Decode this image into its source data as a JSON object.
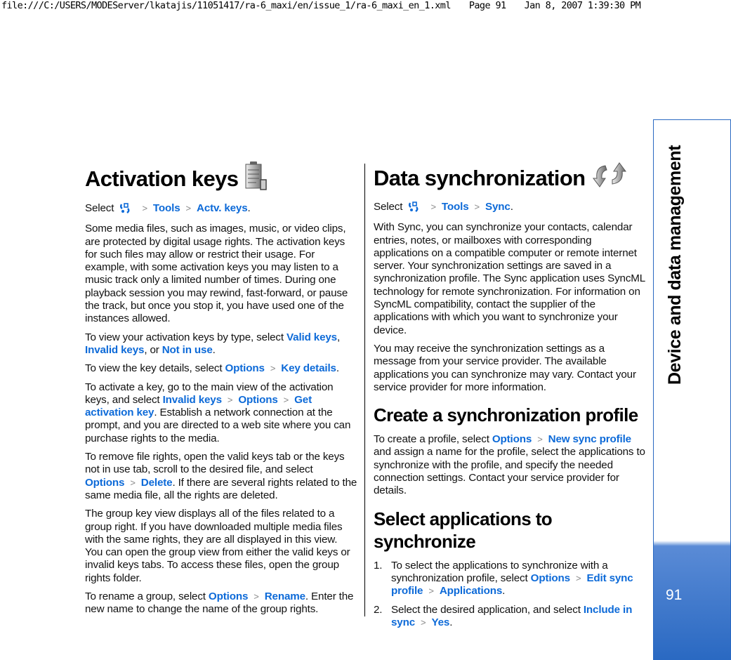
{
  "print_header": {
    "file_path": "file:///C:/USERS/MODEServer/lkatajis/11051417/ra-6_maxi/en/issue_1/ra-6_maxi_en_1.xml",
    "page_label": "Page 91",
    "timestamp": "Jan 8, 2007 1:39:30 PM"
  },
  "side_tab": {
    "chapter_title": "Device and data management",
    "page_number": "91",
    "accent_color": "#2a69c2"
  },
  "link_color": "#0d6ad8",
  "left_column": {
    "title": "Activation keys",
    "title_icon": "activation-keys-icon",
    "select_path": {
      "prefix": "Select",
      "menu_icon": "menu-key-icon",
      "items": [
        "Tools",
        "Actv. keys"
      ],
      "suffix": "."
    },
    "para1": "Some media files, such as images, music, or video clips, are protected by digital usage rights. The activation keys for such files may allow or restrict their usage. For example, with some activation keys you may listen to a music track only a limited number of times. During one playback session you may rewind, fast-forward, or pause the track, but once you stop it, you have used one of the instances allowed.",
    "para2": {
      "text_before": "To view your activation keys by type, select ",
      "link1": "Valid keys",
      "text_mid1": ", ",
      "link2": "Invalid keys",
      "text_mid2": ", or ",
      "link3": "Not in use",
      "text_after": "."
    },
    "para3": {
      "text_before": "To view the key details, select ",
      "link1": "Options",
      "link2": "Key details",
      "text_after": "."
    },
    "para4": {
      "text_before": "To activate a key, go to the main view of the activation keys, and select ",
      "link1": "Invalid keys",
      "link2": "Options",
      "link3": "Get activation key",
      "text_after": ". Establish a network connection at the prompt, and you are directed to a web site where you can purchase rights to the media."
    },
    "para5": {
      "text_before": "To remove file rights, open the valid keys tab or the keys not in use tab, scroll to the desired file, and select ",
      "link1": "Options",
      "link2": "Delete",
      "text_after": ". If there are several rights related to the same media file, all the rights are deleted."
    },
    "para6": "The group key view displays all of the files related to a group right. If you have downloaded multiple media files with the same rights, they are all displayed in this view. You can open the group view from either the valid keys or invalid keys tabs. To access these files, open the group rights folder.",
    "para7": {
      "text_before": "To rename a group, select ",
      "link1": "Options",
      "link2": "Rename",
      "text_after": ". Enter the new name to change the name of the group rights."
    }
  },
  "right_column": {
    "title": "Data synchronization",
    "title_icon": "sync-icon",
    "select_path": {
      "prefix": "Select",
      "menu_icon": "menu-key-icon",
      "items": [
        "Tools",
        "Sync"
      ],
      "suffix": "."
    },
    "para1": "With Sync, you can synchronize your contacts, calendar entries, notes, or mailboxes with corresponding applications on a compatible computer or remote internet server. Your synchronization settings are saved in a synchronization profile. The Sync application uses SyncML technology for remote synchronization. For information on SyncML compatibility, contact the supplier of the applications with which you want to synchronize your device.",
    "para2": "You may receive the synchronization settings as a message from your service provider. The available applications you can synchronize may vary. Contact your service provider for more information.",
    "section1": {
      "heading": "Create a synchronization profile",
      "text_before": "To create a profile, select ",
      "link1": "Options",
      "link2": "New sync profile",
      "text_after": " and assign a name for the profile, select the applications to synchronize with the profile, and specify the needed connection settings. Contact your service provider for details."
    },
    "section2": {
      "heading": "Select applications to synchronize",
      "steps": [
        {
          "number": "1.",
          "text_before": "To select the applications to synchronize with a synchronization profile, select ",
          "link1": "Options",
          "link2": "Edit sync profile",
          "link3": "Applications",
          "text_after": "."
        },
        {
          "number": "2.",
          "text_before": "Select the desired application, and select ",
          "link1": "Include in sync",
          "link2": "Yes",
          "text_after": "."
        }
      ]
    }
  },
  "separator_glyph": ">"
}
